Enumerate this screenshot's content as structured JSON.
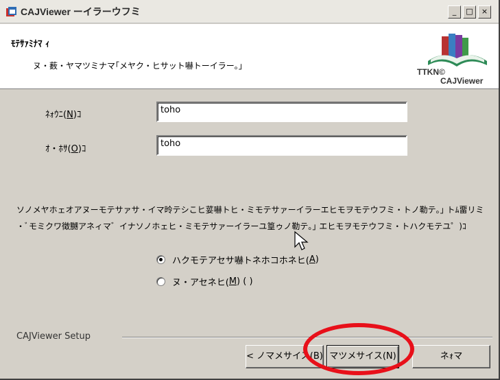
{
  "window": {
    "title": "CAJViewer ーイラーウフミ",
    "minimize": "_",
    "maximize": "□",
    "close": "×"
  },
  "header": {
    "title": "ﾓﾃｻｧﾐﾅﾏ ｨ",
    "subtitle": "ヌ・薮・ヤマツミナマ｢メヤク・ヒサット嚇トーイラー｡｣",
    "logo_text_1": "TTKN©",
    "logo_text_2": "CAJViewer"
  },
  "form": {
    "name_label_pre": "ﾈｫｳﾆ(",
    "name_label_key": "N",
    "name_label_post": ")ｺ",
    "name_value": "toho",
    "org_label_pre": "ｵ・ﾎｻ(",
    "org_label_key": "O",
    "org_label_post": ")ｺ",
    "org_value": "toho"
  },
  "description": {
    "line1": "ソノメヤホェオアヌーモテサァサ・イマ昤テシこヒ荽嚇トヒ・ミモテサァーイラーエヒモヲモテウフミ・トノ勒テ｡｣ トﾑ畱リミ",
    "line2": "・ﾞモミクワ徴嬲アネィマ゛イナソノホェヒ・ミモテサァーイラーユ篁ゥノ勒テ｡｣ エヒモヲモテウフミ・トハクモテユ゜)ｺ"
  },
  "radios": {
    "option1_pre": "ハクモテアセサ嚇トネホコホネヒ(",
    "option1_key": "A",
    "option1_post": ")",
    "option2_pre": "ヌ・アセネヒ(",
    "option2_key": "M",
    "option2_post": ") ( )"
  },
  "footer": {
    "group_label": "CAJViewer Setup",
    "back_label": "< ノマメサイス(B)",
    "next_label": "マツメサイス(N)",
    "cancel_label": "ネｫマ"
  },
  "colors": {
    "highlight": "#e8101a",
    "dialog_bg": "#d4d0c8"
  }
}
